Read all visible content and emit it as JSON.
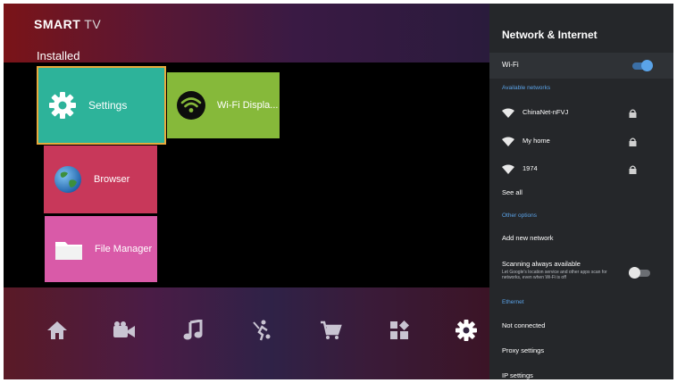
{
  "brand": {
    "bold": "SMART",
    "light": "TV"
  },
  "section_title": "Installed",
  "apps": [
    {
      "label": "Settings",
      "icon": "gear-icon",
      "color": "#2db39a",
      "selected": true
    },
    {
      "label": "Wi-Fi Displa...",
      "icon": "wifi-display-icon",
      "color": "#86b93a"
    },
    {
      "label": "Browser",
      "icon": "globe-icon",
      "color": "#c8385a"
    },
    {
      "label": "File Manager",
      "icon": "folder-icon",
      "color": "#d95aa8"
    }
  ],
  "dock": [
    {
      "icon": "home-icon"
    },
    {
      "icon": "video-icon"
    },
    {
      "icon": "music-icon"
    },
    {
      "icon": "sports-icon"
    },
    {
      "icon": "shopping-cart-icon"
    },
    {
      "icon": "apps-icon"
    },
    {
      "icon": "settings-icon",
      "active": true
    }
  ],
  "panel": {
    "title": "Network & Internet",
    "wifi_label": "Wi-Fi",
    "wifi_enabled": true,
    "available_header": "Available networks",
    "networks": [
      {
        "name": "ChinaNet-nFVJ",
        "secured": true
      },
      {
        "name": "My home",
        "secured": true
      },
      {
        "name": "1974",
        "secured": true
      }
    ],
    "see_all": "See all",
    "other_header": "Other options",
    "add_network": "Add new network",
    "scanning_label": "Scanning always available",
    "scanning_desc": "Let Google's location service and other apps scan for networks, even when Wi-Fi is off",
    "scanning_enabled": false,
    "ethernet_header": "Ethernet",
    "not_connected": "Not connected",
    "proxy": "Proxy settings",
    "ip": "IP settings"
  },
  "colors": {
    "accent_blue": "#5aa3e8",
    "panel_bg": "#25272a",
    "focus_border": "#e8a93c"
  }
}
